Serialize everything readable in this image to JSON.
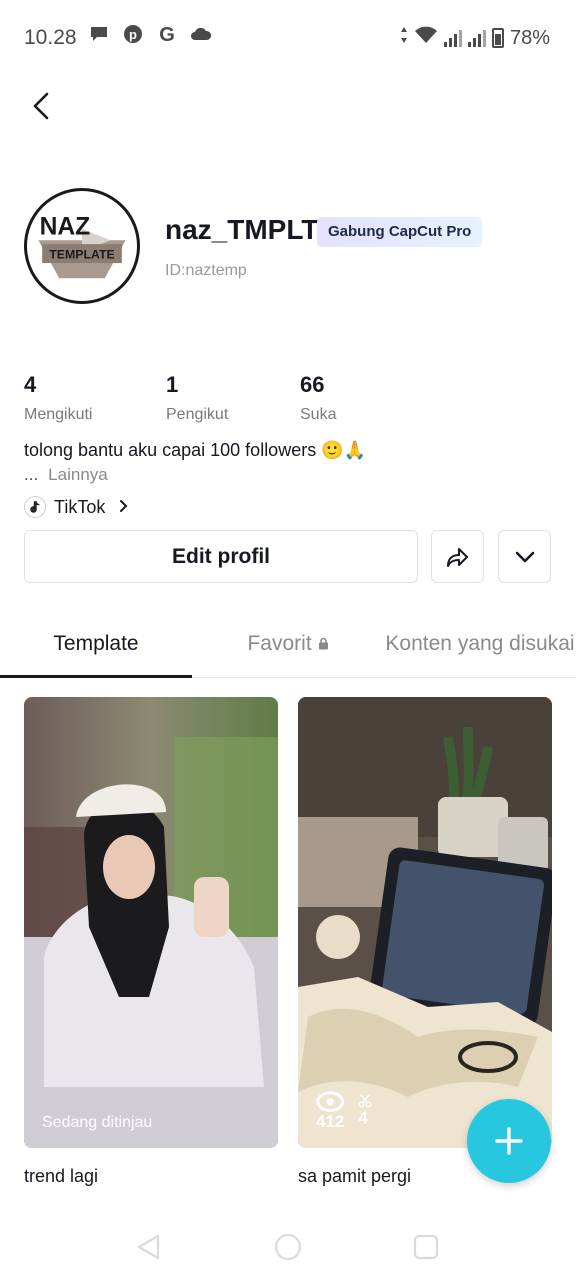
{
  "status_bar": {
    "time": "10.28",
    "battery": "78%",
    "left_icons": [
      "chat-icon",
      "pinterest-icon",
      "google-icon",
      "cloud-icon"
    ],
    "right_icons": [
      "data-arrows-icon",
      "wifi-icon",
      "signal-icon",
      "battery-icon"
    ]
  },
  "profile": {
    "avatar_line1": "NAZ",
    "avatar_line2": "TEMPLATE",
    "username": "naz_TMPLT",
    "pro_badge": "Gabung CapCut Pro",
    "user_id": "ID:naztemp",
    "stats": [
      {
        "value": "4",
        "label": "Mengikuti"
      },
      {
        "value": "1",
        "label": "Pengikut"
      },
      {
        "value": "66",
        "label": "Suka"
      }
    ],
    "bio": "tolong bantu aku capai 100 followers 🙂🙏",
    "bio_more_dots": "...",
    "bio_more_label": "Lainnya",
    "linked_account": "TikTok"
  },
  "actions": {
    "edit_label": "Edit profil",
    "share_icon": "share-icon",
    "dropdown_icon": "chevron-down-icon"
  },
  "tabs": [
    {
      "label": "Template",
      "active": true
    },
    {
      "label": "Favorit",
      "locked": true
    },
    {
      "label": "Konten yang disukai"
    }
  ],
  "templates": [
    {
      "title": "trend lagi",
      "status": "Sedang ditinjau"
    },
    {
      "title": "sa pamit pergi",
      "views": "412",
      "uses": "4"
    }
  ],
  "colors": {
    "fab": "#27c8df",
    "text_primary": "#161823",
    "text_secondary": "#7a7a7a"
  }
}
